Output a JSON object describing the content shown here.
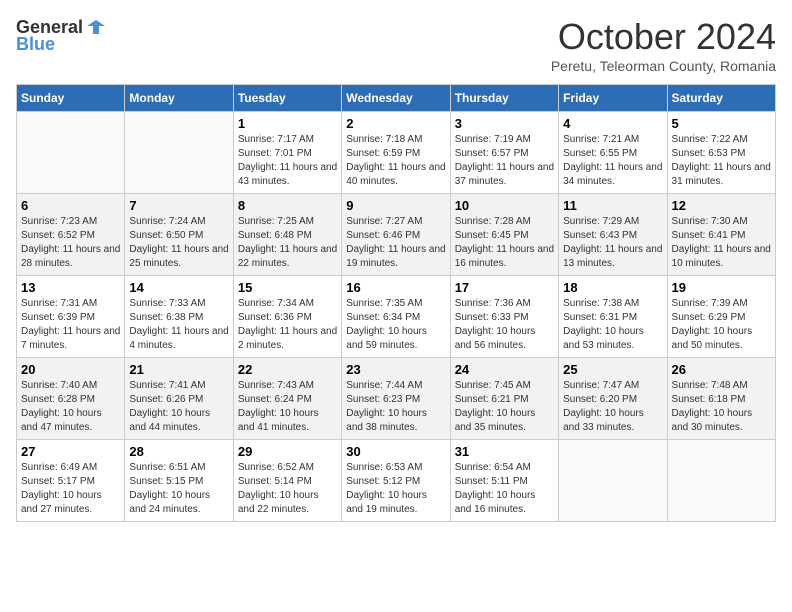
{
  "header": {
    "logo_general": "General",
    "logo_blue": "Blue",
    "month_title": "October 2024",
    "subtitle": "Peretu, Teleorman County, Romania"
  },
  "weekdays": [
    "Sunday",
    "Monday",
    "Tuesday",
    "Wednesday",
    "Thursday",
    "Friday",
    "Saturday"
  ],
  "weeks": [
    [
      {
        "day": "",
        "detail": ""
      },
      {
        "day": "",
        "detail": ""
      },
      {
        "day": "1",
        "detail": "Sunrise: 7:17 AM\nSunset: 7:01 PM\nDaylight: 11 hours and 43 minutes."
      },
      {
        "day": "2",
        "detail": "Sunrise: 7:18 AM\nSunset: 6:59 PM\nDaylight: 11 hours and 40 minutes."
      },
      {
        "day": "3",
        "detail": "Sunrise: 7:19 AM\nSunset: 6:57 PM\nDaylight: 11 hours and 37 minutes."
      },
      {
        "day": "4",
        "detail": "Sunrise: 7:21 AM\nSunset: 6:55 PM\nDaylight: 11 hours and 34 minutes."
      },
      {
        "day": "5",
        "detail": "Sunrise: 7:22 AM\nSunset: 6:53 PM\nDaylight: 11 hours and 31 minutes."
      }
    ],
    [
      {
        "day": "6",
        "detail": "Sunrise: 7:23 AM\nSunset: 6:52 PM\nDaylight: 11 hours and 28 minutes."
      },
      {
        "day": "7",
        "detail": "Sunrise: 7:24 AM\nSunset: 6:50 PM\nDaylight: 11 hours and 25 minutes."
      },
      {
        "day": "8",
        "detail": "Sunrise: 7:25 AM\nSunset: 6:48 PM\nDaylight: 11 hours and 22 minutes."
      },
      {
        "day": "9",
        "detail": "Sunrise: 7:27 AM\nSunset: 6:46 PM\nDaylight: 11 hours and 19 minutes."
      },
      {
        "day": "10",
        "detail": "Sunrise: 7:28 AM\nSunset: 6:45 PM\nDaylight: 11 hours and 16 minutes."
      },
      {
        "day": "11",
        "detail": "Sunrise: 7:29 AM\nSunset: 6:43 PM\nDaylight: 11 hours and 13 minutes."
      },
      {
        "day": "12",
        "detail": "Sunrise: 7:30 AM\nSunset: 6:41 PM\nDaylight: 11 hours and 10 minutes."
      }
    ],
    [
      {
        "day": "13",
        "detail": "Sunrise: 7:31 AM\nSunset: 6:39 PM\nDaylight: 11 hours and 7 minutes."
      },
      {
        "day": "14",
        "detail": "Sunrise: 7:33 AM\nSunset: 6:38 PM\nDaylight: 11 hours and 4 minutes."
      },
      {
        "day": "15",
        "detail": "Sunrise: 7:34 AM\nSunset: 6:36 PM\nDaylight: 11 hours and 2 minutes."
      },
      {
        "day": "16",
        "detail": "Sunrise: 7:35 AM\nSunset: 6:34 PM\nDaylight: 10 hours and 59 minutes."
      },
      {
        "day": "17",
        "detail": "Sunrise: 7:36 AM\nSunset: 6:33 PM\nDaylight: 10 hours and 56 minutes."
      },
      {
        "day": "18",
        "detail": "Sunrise: 7:38 AM\nSunset: 6:31 PM\nDaylight: 10 hours and 53 minutes."
      },
      {
        "day": "19",
        "detail": "Sunrise: 7:39 AM\nSunset: 6:29 PM\nDaylight: 10 hours and 50 minutes."
      }
    ],
    [
      {
        "day": "20",
        "detail": "Sunrise: 7:40 AM\nSunset: 6:28 PM\nDaylight: 10 hours and 47 minutes."
      },
      {
        "day": "21",
        "detail": "Sunrise: 7:41 AM\nSunset: 6:26 PM\nDaylight: 10 hours and 44 minutes."
      },
      {
        "day": "22",
        "detail": "Sunrise: 7:43 AM\nSunset: 6:24 PM\nDaylight: 10 hours and 41 minutes."
      },
      {
        "day": "23",
        "detail": "Sunrise: 7:44 AM\nSunset: 6:23 PM\nDaylight: 10 hours and 38 minutes."
      },
      {
        "day": "24",
        "detail": "Sunrise: 7:45 AM\nSunset: 6:21 PM\nDaylight: 10 hours and 35 minutes."
      },
      {
        "day": "25",
        "detail": "Sunrise: 7:47 AM\nSunset: 6:20 PM\nDaylight: 10 hours and 33 minutes."
      },
      {
        "day": "26",
        "detail": "Sunrise: 7:48 AM\nSunset: 6:18 PM\nDaylight: 10 hours and 30 minutes."
      }
    ],
    [
      {
        "day": "27",
        "detail": "Sunrise: 6:49 AM\nSunset: 5:17 PM\nDaylight: 10 hours and 27 minutes."
      },
      {
        "day": "28",
        "detail": "Sunrise: 6:51 AM\nSunset: 5:15 PM\nDaylight: 10 hours and 24 minutes."
      },
      {
        "day": "29",
        "detail": "Sunrise: 6:52 AM\nSunset: 5:14 PM\nDaylight: 10 hours and 22 minutes."
      },
      {
        "day": "30",
        "detail": "Sunrise: 6:53 AM\nSunset: 5:12 PM\nDaylight: 10 hours and 19 minutes."
      },
      {
        "day": "31",
        "detail": "Sunrise: 6:54 AM\nSunset: 5:11 PM\nDaylight: 10 hours and 16 minutes."
      },
      {
        "day": "",
        "detail": ""
      },
      {
        "day": "",
        "detail": ""
      }
    ]
  ]
}
